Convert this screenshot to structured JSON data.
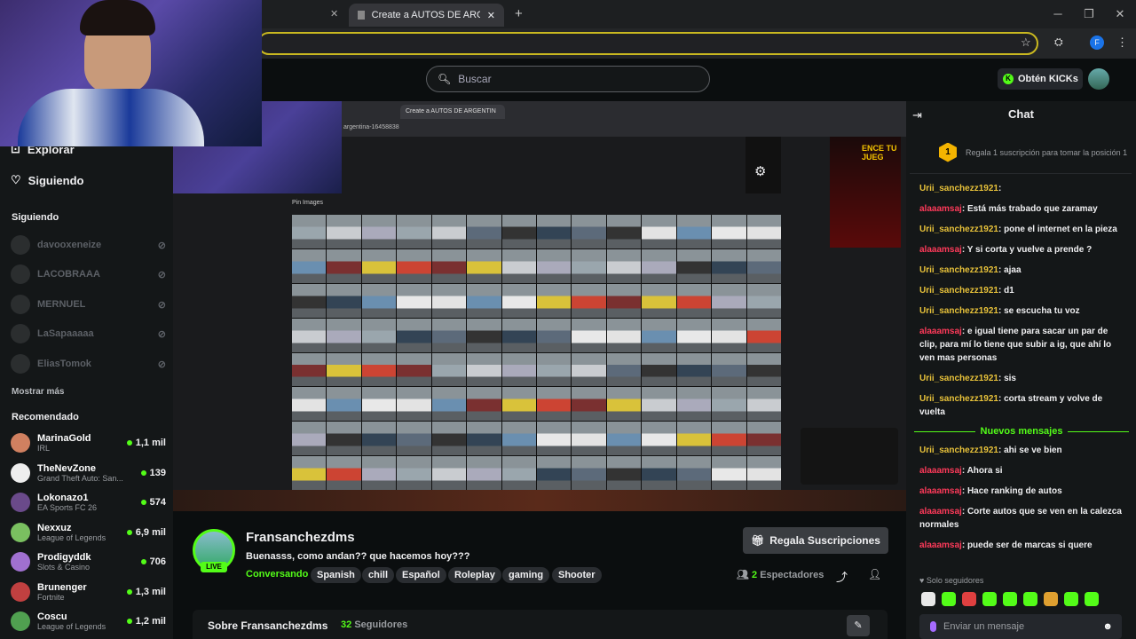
{
  "browser": {
    "active_tab": "Create a AUTOS DE ARGENTIN",
    "inner_url": "argentina-16458838",
    "colors": {
      "kick_green": "#53fc18",
      "gold": "#e8c23a",
      "red_user": "#ff3a5a"
    }
  },
  "header": {
    "search_placeholder": "Buscar",
    "kicks_label": "Obtén KICKs"
  },
  "sidebar": {
    "explore": "Explorar",
    "following_nav": "Siguiendo",
    "following_heading": "Siguiendo",
    "following": [
      "davooxeneize",
      "LACOBRAAA",
      "MERNUEL",
      "LaSapaaaaa",
      "EliasTomok"
    ],
    "show_more": "Mostrar más",
    "recommended_heading": "Recomendado",
    "recommended": [
      {
        "name": "MarinaGold",
        "game": "IRL",
        "viewers": "1,1 mil",
        "color": "#d08060"
      },
      {
        "name": "TheNevZone",
        "game": "Grand Theft Auto: San...",
        "viewers": "139",
        "color": "#eeeeee"
      },
      {
        "name": "Lokonazo1",
        "game": "EA Sports FC 26",
        "viewers": "574",
        "color": "#6a4a8a"
      },
      {
        "name": "Nexxuz",
        "game": "League of Legends",
        "viewers": "6,9 mil",
        "color": "#7ac060"
      },
      {
        "name": "Prodigyddk",
        "game": "Slots & Casino",
        "viewers": "706",
        "color": "#a070d0"
      },
      {
        "name": "Brunenger",
        "game": "Fortnite",
        "viewers": "1,3 mil",
        "color": "#c04040"
      },
      {
        "name": "Coscu",
        "game": "League of Legends",
        "viewers": "1,2 mil",
        "color": "#50a050"
      }
    ]
  },
  "player": {
    "pin_label": "Pin Images",
    "ad_text": "ENCE TU JUEG"
  },
  "stream": {
    "live": "LIVE",
    "name": "Fransanchezdms",
    "title": "Buenasss, como andan?? que hacemos hoy???",
    "category": "Conversando",
    "tags": [
      "Spanish",
      "chill",
      "Español",
      "Roleplay",
      "gaming",
      "Shooter"
    ],
    "gift_label": "Regala Suscripciones",
    "viewers_count": "2",
    "viewers_label": "Espectadores",
    "about": "Sobre Fransanchezdms",
    "followers_count": "32",
    "followers_label": "Seguidores"
  },
  "chat": {
    "title": "Chat",
    "sub_promo_rank": "1",
    "sub_promo": "Regala 1 suscripción para tomar la posición 1",
    "messages": [
      {
        "user": "Urii_sanchezz1921",
        "text": "",
        "cls": "u-y"
      },
      {
        "user": "alaaamsaj",
        "text": "Está más trabado que zaramay",
        "cls": "u-r"
      },
      {
        "user": "Urii_sanchezz1921",
        "text": "pone el internet en la pieza",
        "cls": "u-y"
      },
      {
        "user": "alaaamsaj",
        "text": "Y si corta y vuelve a prende ?",
        "cls": "u-r"
      },
      {
        "user": "Urii_sanchezz1921",
        "text": "ajaa",
        "cls": "u-y"
      },
      {
        "user": "Urii_sanchezz1921",
        "text": "d1",
        "cls": "u-y"
      },
      {
        "user": "Urii_sanchezz1921",
        "text": "se escucha tu voz",
        "cls": "u-y"
      },
      {
        "user": "alaaamsaj",
        "text": "e igual tiene para sacar un par de clip, para mí lo tiene que subir a ig, que ahí lo ven mas personas",
        "cls": "u-r"
      },
      {
        "user": "Urii_sanchezz1921",
        "text": "sis",
        "cls": "u-y"
      },
      {
        "user": "Urii_sanchezz1921",
        "text": "corta stream y volve de vuelta",
        "cls": "u-y"
      }
    ],
    "new_messages": "Nuevos mensajes",
    "messages_after": [
      {
        "user": "Urii_sanchezz1921",
        "text": "ahi se ve bien",
        "cls": "u-y"
      },
      {
        "user": "alaaamsaj",
        "text": "Ahora si",
        "cls": "u-r"
      },
      {
        "user": "alaaamsaj",
        "text": "Hace ranking de autos",
        "cls": "u-r"
      },
      {
        "user": "alaaamsaj",
        "text": "Corte autos que se ven en la calezca normales",
        "cls": "u-r"
      },
      {
        "user": "alaaamsaj",
        "text": "puede ser de marcas si quere",
        "cls": "u-r"
      }
    ],
    "followers_only": "Solo seguidores",
    "input_placeholder": "Enviar un mensaje"
  }
}
